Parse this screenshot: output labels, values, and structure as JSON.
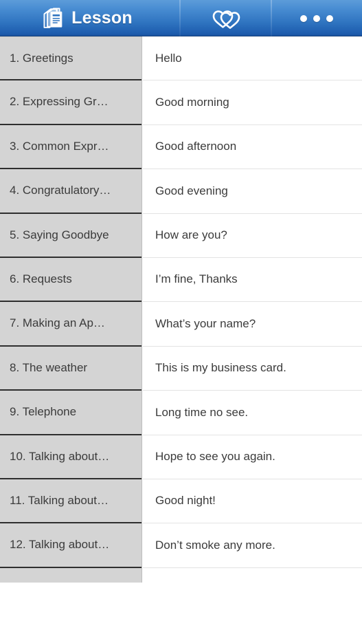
{
  "header": {
    "title": "Lesson",
    "doc_icon": "documents-stack-icon",
    "favorites_icon": "two-hearts-icon",
    "more_icon": "three-dots-overflow-icon",
    "accent_color": "#2f74c0",
    "title_color": "#ffffff"
  },
  "sidebar": {
    "background_color": "#d4d4d4",
    "divider_color": "#2e2e2e",
    "text_color": "#3b3b3b",
    "items": [
      {
        "label": "1. Greetings"
      },
      {
        "label": "2. Expressing Gr…"
      },
      {
        "label": "3. Common Expr…"
      },
      {
        "label": "4. Congratulatory…"
      },
      {
        "label": "5. Saying Goodbye"
      },
      {
        "label": "6. Requests"
      },
      {
        "label": "7. Making an Ap…"
      },
      {
        "label": "8. The weather"
      },
      {
        "label": "9. Telephone"
      },
      {
        "label": "10. Talking about…"
      },
      {
        "label": "11. Talking about…"
      },
      {
        "label": "12. Talking about…"
      },
      {
        "label": ""
      }
    ]
  },
  "phrase_list": {
    "background_color": "#ffffff",
    "divider_color": "#e3e3e3",
    "text_color": "#3b3b3b",
    "items": [
      {
        "label": "Hello"
      },
      {
        "label": "Good morning"
      },
      {
        "label": "Good afternoon"
      },
      {
        "label": "Good evening"
      },
      {
        "label": "How are you?"
      },
      {
        "label": "I’m fine, Thanks"
      },
      {
        "label": "What’s your name?"
      },
      {
        "label": "This is my business card."
      },
      {
        "label": "Long time no see."
      },
      {
        "label": "Hope to see you again."
      },
      {
        "label": "Good night!"
      },
      {
        "label": "Don’t smoke any more."
      }
    ]
  }
}
